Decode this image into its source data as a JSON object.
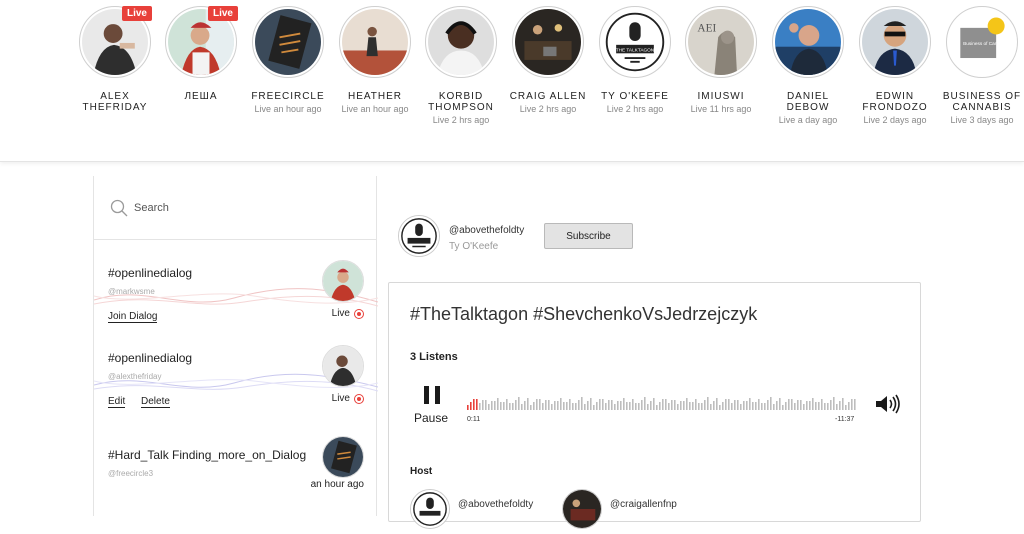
{
  "stories": [
    {
      "name": "ALEX\nTHEFRIDAY",
      "status": "",
      "live": true
    },
    {
      "name": "ЛЕША",
      "status": "",
      "live": true
    },
    {
      "name": "FREECIRCLE",
      "status": "Live an hour ago",
      "live": false
    },
    {
      "name": "HEATHER",
      "status": "Live an hour ago",
      "live": false
    },
    {
      "name": "KORBID\nTHOMPSON",
      "status": "Live 2 hrs ago",
      "live": false
    },
    {
      "name": "CRAIG ALLEN",
      "status": "Live 2 hrs ago",
      "live": false
    },
    {
      "name": "TY O'KEEFE",
      "status": "Live 2 hrs ago",
      "live": false
    },
    {
      "name": "IMIUSWI",
      "status": "Live 11 hrs ago",
      "live": false
    },
    {
      "name": "DANIEL\nDEBOW",
      "status": "Live a day ago",
      "live": false
    },
    {
      "name": "EDWIN\nFRONDOZO",
      "status": "Live 2 days ago",
      "live": false
    },
    {
      "name": "BUSINESS OF\nCANNABIS",
      "status": "Live 3 days ago",
      "live": false
    }
  ],
  "live_tag": "Live",
  "avatar_texts": {
    "talktagon": "THE TALKTAGON",
    "aei": "AEI",
    "business": "Business of Cannabis"
  },
  "search": {
    "placeholder": "Search"
  },
  "dialogs": [
    {
      "title": "#openlinedialog",
      "handle": "@markwsme",
      "actions": [
        "Join Dialog"
      ],
      "status": "Live",
      "live": true
    },
    {
      "title": "#openlinedialog",
      "handle": "@alexthefriday",
      "actions": [
        "Edit",
        "Delete"
      ],
      "status": "Live",
      "live": true
    },
    {
      "title": "#Hard_Talk Finding_more_on_Dialog",
      "handle": "@freecircle3",
      "actions": [],
      "status": "an hour ago",
      "live": false
    }
  ],
  "owner": {
    "handle": "@abovethefoldty",
    "name": "Ty O'Keefe",
    "subscribe_label": "Subscribe"
  },
  "player": {
    "title": "#TheTalktagon #ShevchenkoVsJedrzejczyk",
    "listens": "3 Listens",
    "pause_label": "Pause",
    "time_elapsed": "0:11",
    "time_remaining": "-11:37",
    "progress": 0.013
  },
  "host": {
    "label": "Host",
    "people": [
      {
        "handle": "@abovethefoldty"
      },
      {
        "handle": "@craigallenfnp"
      }
    ]
  },
  "colors": {
    "live_red": "#e8403a",
    "wave_gray": "#bdbdbd",
    "wave_played": "#e8403a"
  }
}
